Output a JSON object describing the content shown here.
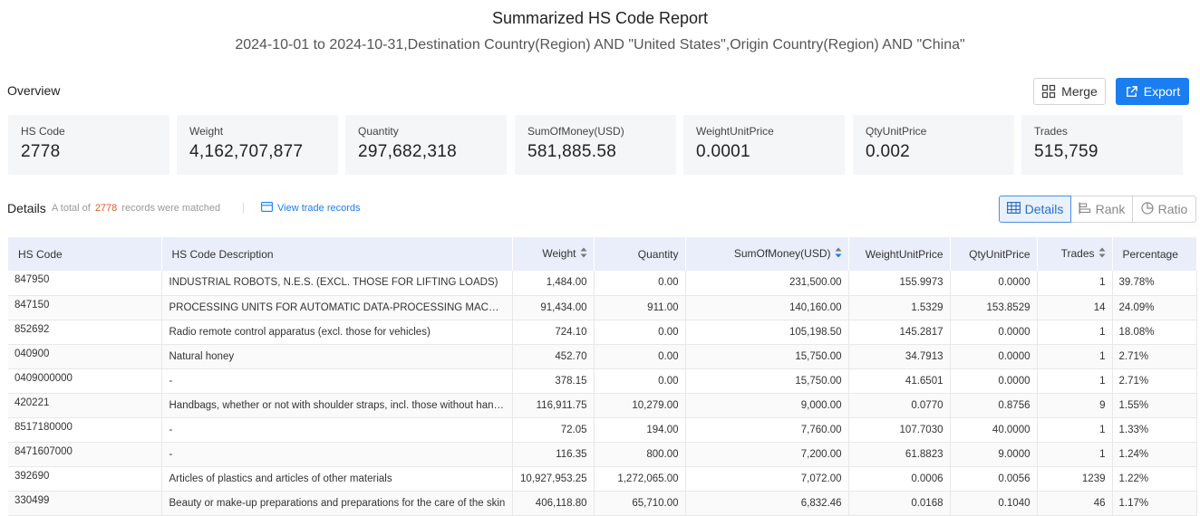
{
  "header": {
    "title": "Summarized HS Code Report",
    "subtitle": "2024-10-01 to 2024-10-31,Destination Country(Region) AND \"United States\",Origin Country(Region) AND \"China\""
  },
  "overview": {
    "label": "Overview",
    "merge_label": "Merge",
    "export_label": "Export",
    "cards": [
      {
        "label": "HS Code",
        "value": "2778"
      },
      {
        "label": "Weight",
        "value": "4,162,707,877"
      },
      {
        "label": "Quantity",
        "value": "297,682,318"
      },
      {
        "label": "SumOfMoney(USD)",
        "value": "581,885.58"
      },
      {
        "label": "WeightUnitPrice",
        "value": "0.0001"
      },
      {
        "label": "QtyUnitPrice",
        "value": "0.002"
      },
      {
        "label": "Trades",
        "value": "515,759"
      }
    ]
  },
  "details": {
    "label": "Details",
    "total_prefix": "A total of",
    "total_count": "2778",
    "total_suffix": "records were matched",
    "view_link": "View trade records",
    "views": {
      "details": "Details",
      "rank": "Rank",
      "ratio": "Ratio"
    }
  },
  "table": {
    "columns": [
      "HS Code",
      "HS Code Description",
      "Weight",
      "Quantity",
      "SumOfMoney(USD)",
      "WeightUnitPrice",
      "QtyUnitPrice",
      "Trades",
      "Percentage"
    ],
    "rows": [
      {
        "code": "847950",
        "desc": "INDUSTRIAL ROBOTS, N.E.S. (EXCL. THOSE FOR LIFTING LOADS)",
        "weight": "1,484.00",
        "qty": "0.00",
        "money": "231,500.00",
        "wup": "155.9973",
        "qup": "0.0000",
        "trades": "1",
        "pct": "39.78%"
      },
      {
        "code": "847150",
        "desc": "PROCESSING UNITS FOR AUTOMATIC DATA-PROCESSING MACHINES, WHETHER OR NOT CONTAINING IN THE SAME HOUSING ONE OR TWO OF THE FOLLOWING TYPES OF UNIT",
        "weight": "91,434.00",
        "qty": "911.00",
        "money": "140,160.00",
        "wup": "1.5329",
        "qup": "153.8529",
        "trades": "14",
        "pct": "24.09%"
      },
      {
        "code": "852692",
        "desc": "Radio remote control apparatus (excl. those for vehicles)",
        "weight": "724.10",
        "qty": "0.00",
        "money": "105,198.50",
        "wup": "145.2817",
        "qup": "0.0000",
        "trades": "1",
        "pct": "18.08%"
      },
      {
        "code": "040900",
        "desc": "Natural honey",
        "weight": "452.70",
        "qty": "0.00",
        "money": "15,750.00",
        "wup": "34.7913",
        "qup": "0.0000",
        "trades": "1",
        "pct": "2.71%"
      },
      {
        "code": "0409000000",
        "desc": "-",
        "weight": "378.15",
        "qty": "0.00",
        "money": "15,750.00",
        "wup": "41.6501",
        "qup": "0.0000",
        "trades": "1",
        "pct": "2.71%"
      },
      {
        "code": "420221",
        "desc": "Handbags, whether or not with shoulder straps, incl. those without handle, with outer surface of leather",
        "weight": "116,911.75",
        "qty": "10,279.00",
        "money": "9,000.00",
        "wup": "0.0770",
        "qup": "0.8756",
        "trades": "9",
        "pct": "1.55%"
      },
      {
        "code": "8517180000",
        "desc": "-",
        "weight": "72.05",
        "qty": "194.00",
        "money": "7,760.00",
        "wup": "107.7030",
        "qup": "40.0000",
        "trades": "1",
        "pct": "1.33%"
      },
      {
        "code": "8471607000",
        "desc": "-",
        "weight": "116.35",
        "qty": "800.00",
        "money": "7,200.00",
        "wup": "61.8823",
        "qup": "9.0000",
        "trades": "1",
        "pct": "1.24%"
      },
      {
        "code": "392690",
        "desc": "Articles of plastics and articles of other materials",
        "weight": "10,927,953.25",
        "qty": "1,272,065.00",
        "money": "7,072.00",
        "wup": "0.0006",
        "qup": "0.0056",
        "trades": "1239",
        "pct": "1.22%"
      },
      {
        "code": "330499",
        "desc": "Beauty or make-up preparations and preparations for the care of the skin",
        "weight": "406,118.80",
        "qty": "65,710.00",
        "money": "6,832.46",
        "wup": "0.0168",
        "qup": "0.1040",
        "trades": "46",
        "pct": "1.17%"
      }
    ]
  },
  "colors": {
    "accent": "#1a7ef0",
    "count": "#e05a2a",
    "header_bg": "#e9eefa",
    "card_bg": "#f5f6f8"
  }
}
